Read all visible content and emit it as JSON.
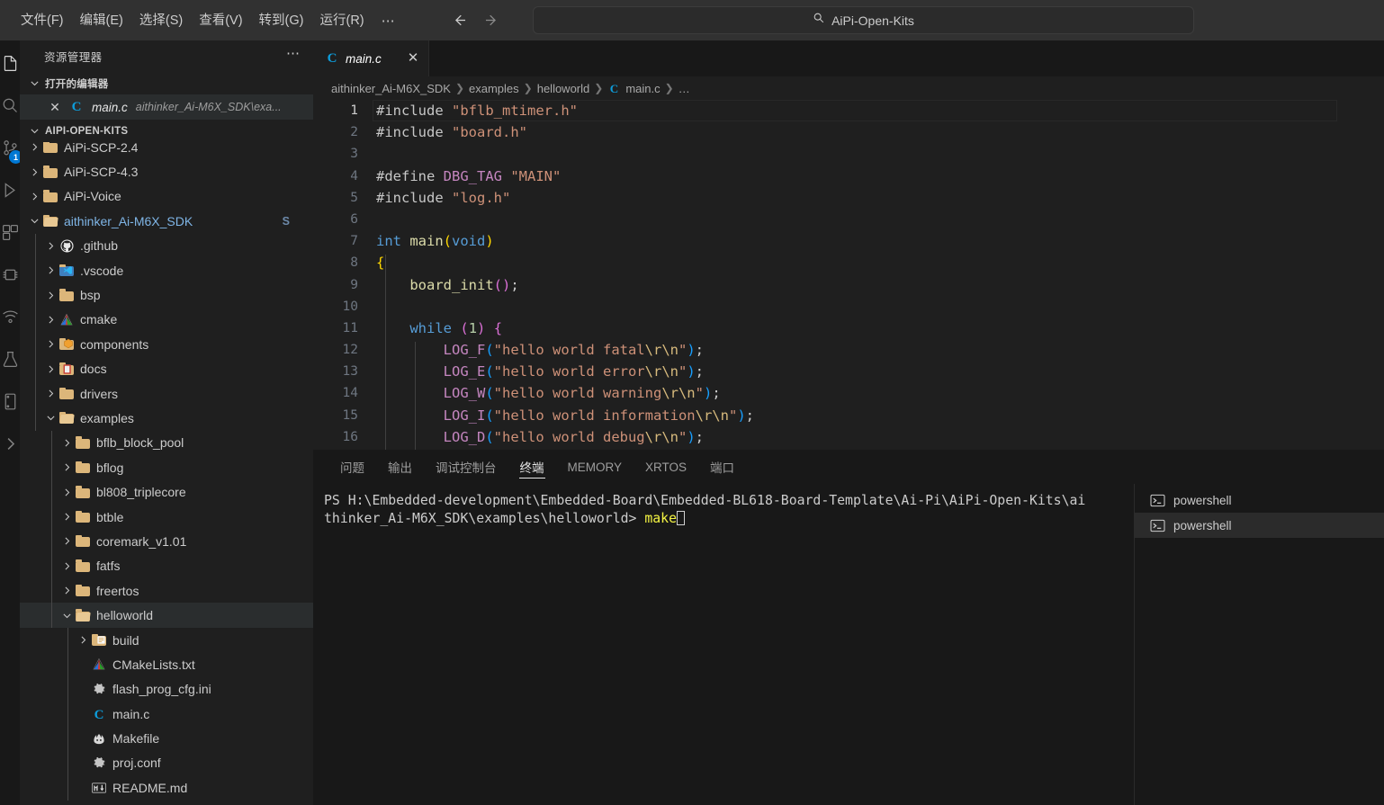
{
  "titlebar": {
    "menus": [
      "文件(F)",
      "编辑(E)",
      "选择(S)",
      "查看(V)",
      "转到(G)",
      "运行(R)"
    ],
    "more_label": "⋯",
    "back_icon": "arrow-left-icon",
    "forward_icon": "arrow-right-icon",
    "search": {
      "icon": "search-icon",
      "text": "AiPi-Open-Kits"
    }
  },
  "activitybar": {
    "items": [
      {
        "name": "explorer",
        "icon": "files-icon",
        "active": true
      },
      {
        "name": "search",
        "icon": "search-icon"
      },
      {
        "name": "source-control",
        "icon": "source-control-icon",
        "badge": "1"
      },
      {
        "name": "run-and-debug",
        "icon": "run-debug-icon"
      },
      {
        "name": "extensions",
        "icon": "extensions-icon"
      },
      {
        "name": "platformio",
        "icon": "platformio-icon"
      },
      {
        "name": "remote-explorer",
        "icon": "remote-icon"
      },
      {
        "name": "test",
        "icon": "beaker-icon"
      },
      {
        "name": "serial-monitor",
        "icon": "serial-icon"
      },
      {
        "name": "more-views",
        "icon": "chevron-right-icon"
      }
    ]
  },
  "sidebar": {
    "title": "资源管理器",
    "more_icon": "ellipsis-icon",
    "open_editors": {
      "label": "打开的编辑器",
      "items": [
        {
          "close_icon": "close-icon",
          "file_icon": "c-file-icon",
          "name": "main.c",
          "path": "aithinker_Ai-M6X_SDK\\exa..."
        }
      ]
    },
    "workspace": {
      "label": "AIPI-OPEN-KITS",
      "tree": [
        {
          "label": "AiPi-SCP-2.4",
          "depth": 1,
          "type": "folder",
          "state": "collapsed",
          "clipped": true
        },
        {
          "label": "AiPi-SCP-4.3",
          "depth": 1,
          "type": "folder",
          "state": "collapsed"
        },
        {
          "label": "AiPi-Voice",
          "depth": 1,
          "type": "folder",
          "state": "collapsed"
        },
        {
          "label": "aithinker_Ai-M6X_SDK",
          "depth": 1,
          "type": "folder",
          "state": "expanded",
          "accent": true,
          "git_badge": "S"
        },
        {
          "label": ".github",
          "depth": 2,
          "type": "github",
          "state": "collapsed"
        },
        {
          "label": ".vscode",
          "depth": 2,
          "type": "vscode",
          "state": "collapsed"
        },
        {
          "label": "bsp",
          "depth": 2,
          "type": "folder",
          "state": "collapsed"
        },
        {
          "label": "cmake",
          "depth": 2,
          "type": "cmake",
          "state": "collapsed"
        },
        {
          "label": "components",
          "depth": 2,
          "type": "components",
          "state": "collapsed"
        },
        {
          "label": "docs",
          "depth": 2,
          "type": "docs",
          "state": "collapsed"
        },
        {
          "label": "drivers",
          "depth": 2,
          "type": "folder",
          "state": "collapsed"
        },
        {
          "label": "examples",
          "depth": 2,
          "type": "folder",
          "state": "expanded"
        },
        {
          "label": "bflb_block_pool",
          "depth": 3,
          "type": "folder",
          "state": "collapsed"
        },
        {
          "label": "bflog",
          "depth": 3,
          "type": "folder",
          "state": "collapsed"
        },
        {
          "label": "bl808_triplecore",
          "depth": 3,
          "type": "folder",
          "state": "collapsed"
        },
        {
          "label": "btble",
          "depth": 3,
          "type": "folder",
          "state": "collapsed"
        },
        {
          "label": "coremark_v1.01",
          "depth": 3,
          "type": "folder",
          "state": "collapsed"
        },
        {
          "label": "fatfs",
          "depth": 3,
          "type": "folder",
          "state": "collapsed"
        },
        {
          "label": "freertos",
          "depth": 3,
          "type": "folder",
          "state": "collapsed"
        },
        {
          "label": "helloworld",
          "depth": 3,
          "type": "folder",
          "state": "expanded",
          "selected": true
        },
        {
          "label": "build",
          "depth": 4,
          "type": "buildfolder",
          "state": "collapsed"
        },
        {
          "label": "CMakeLists.txt",
          "depth": 4,
          "type": "cmakefile",
          "state": "leaf"
        },
        {
          "label": "flash_prog_cfg.ini",
          "depth": 4,
          "type": "gear",
          "state": "leaf"
        },
        {
          "label": "main.c",
          "depth": 4,
          "type": "cfile",
          "state": "leaf"
        },
        {
          "label": "Makefile",
          "depth": 4,
          "type": "makefile",
          "state": "leaf"
        },
        {
          "label": "proj.conf",
          "depth": 4,
          "type": "gear",
          "state": "leaf"
        },
        {
          "label": "README.md",
          "depth": 4,
          "type": "markdown",
          "state": "leaf",
          "clipped": true
        }
      ]
    }
  },
  "editor": {
    "tabs": [
      {
        "icon": "c-file-icon",
        "label": "main.c",
        "close_icon": "close-icon",
        "active": true
      }
    ],
    "breadcrumb": [
      {
        "label": "aithinker_Ai-M6X_SDK"
      },
      {
        "label": "examples"
      },
      {
        "label": "helloworld"
      },
      {
        "label": "main.c",
        "icon": "c-file-icon"
      },
      {
        "label": "…"
      }
    ],
    "code_lines": [
      {
        "n": 1,
        "current": true,
        "tokens": [
          {
            "t": "#include ",
            "c": "t-pre"
          },
          {
            "t": "\"bflb_mtimer.h\"",
            "c": "t-str"
          }
        ]
      },
      {
        "n": 2,
        "tokens": [
          {
            "t": "#include ",
            "c": "t-pre"
          },
          {
            "t": "\"board.h\"",
            "c": "t-str"
          }
        ]
      },
      {
        "n": 3,
        "tokens": []
      },
      {
        "n": 4,
        "tokens": [
          {
            "t": "#define ",
            "c": "t-pre"
          },
          {
            "t": "DBG_TAG",
            "c": "t-macro"
          },
          {
            "t": " ",
            "c": "t-pre"
          },
          {
            "t": "\"MAIN\"",
            "c": "t-str"
          }
        ]
      },
      {
        "n": 5,
        "tokens": [
          {
            "t": "#include ",
            "c": "t-pre"
          },
          {
            "t": "\"log.h\"",
            "c": "t-str"
          }
        ]
      },
      {
        "n": 6,
        "tokens": []
      },
      {
        "n": 7,
        "tokens": [
          {
            "t": "int",
            "c": "t-kw"
          },
          {
            "t": " ",
            "c": "t-pre"
          },
          {
            "t": "main",
            "c": "t-fn"
          },
          {
            "t": "(",
            "c": "t-p1"
          },
          {
            "t": "void",
            "c": "t-kw"
          },
          {
            "t": ")",
            "c": "t-p1"
          }
        ]
      },
      {
        "n": 8,
        "tokens": [
          {
            "t": "{",
            "c": "t-p1"
          }
        ]
      },
      {
        "n": 9,
        "tokens": [
          {
            "t": "    ",
            "c": "t-pre"
          },
          {
            "t": "board_init",
            "c": "t-fn"
          },
          {
            "t": "()",
            "c": "t-p2"
          },
          {
            "t": ";",
            "c": "t-punc"
          }
        ]
      },
      {
        "n": 10,
        "tokens": []
      },
      {
        "n": 11,
        "tokens": [
          {
            "t": "    ",
            "c": "t-pre"
          },
          {
            "t": "while",
            "c": "t-kw"
          },
          {
            "t": " ",
            "c": "t-pre"
          },
          {
            "t": "(",
            "c": "t-p2"
          },
          {
            "t": "1",
            "c": "t-num"
          },
          {
            "t": ")",
            "c": "t-p2"
          },
          {
            "t": " ",
            "c": "t-pre"
          },
          {
            "t": "{",
            "c": "t-p2"
          }
        ]
      },
      {
        "n": 12,
        "tokens": [
          {
            "t": "        ",
            "c": "t-pre"
          },
          {
            "t": "LOG_F",
            "c": "t-macro"
          },
          {
            "t": "(",
            "c": "t-p3"
          },
          {
            "t": "\"hello world fatal",
            "c": "t-str"
          },
          {
            "t": "\\r\\n",
            "c": "t-esc"
          },
          {
            "t": "\"",
            "c": "t-str"
          },
          {
            "t": ")",
            "c": "t-p3"
          },
          {
            "t": ";",
            "c": "t-punc"
          }
        ]
      },
      {
        "n": 13,
        "tokens": [
          {
            "t": "        ",
            "c": "t-pre"
          },
          {
            "t": "LOG_E",
            "c": "t-macro"
          },
          {
            "t": "(",
            "c": "t-p3"
          },
          {
            "t": "\"hello world error",
            "c": "t-str"
          },
          {
            "t": "\\r\\n",
            "c": "t-esc"
          },
          {
            "t": "\"",
            "c": "t-str"
          },
          {
            "t": ")",
            "c": "t-p3"
          },
          {
            "t": ";",
            "c": "t-punc"
          }
        ]
      },
      {
        "n": 14,
        "tokens": [
          {
            "t": "        ",
            "c": "t-pre"
          },
          {
            "t": "LOG_W",
            "c": "t-macro"
          },
          {
            "t": "(",
            "c": "t-p3"
          },
          {
            "t": "\"hello world warning",
            "c": "t-str"
          },
          {
            "t": "\\r\\n",
            "c": "t-esc"
          },
          {
            "t": "\"",
            "c": "t-str"
          },
          {
            "t": ")",
            "c": "t-p3"
          },
          {
            "t": ";",
            "c": "t-punc"
          }
        ]
      },
      {
        "n": 15,
        "tokens": [
          {
            "t": "        ",
            "c": "t-pre"
          },
          {
            "t": "LOG_I",
            "c": "t-macro"
          },
          {
            "t": "(",
            "c": "t-p3"
          },
          {
            "t": "\"hello world information",
            "c": "t-str"
          },
          {
            "t": "\\r\\n",
            "c": "t-esc"
          },
          {
            "t": "\"",
            "c": "t-str"
          },
          {
            "t": ")",
            "c": "t-p3"
          },
          {
            "t": ";",
            "c": "t-punc"
          }
        ]
      },
      {
        "n": 16,
        "tokens": [
          {
            "t": "        ",
            "c": "t-pre"
          },
          {
            "t": "LOG_D",
            "c": "t-macro"
          },
          {
            "t": "(",
            "c": "t-p3"
          },
          {
            "t": "\"hello world debug",
            "c": "t-str"
          },
          {
            "t": "\\r\\n",
            "c": "t-esc"
          },
          {
            "t": "\"",
            "c": "t-str"
          },
          {
            "t": ")",
            "c": "t-p3"
          },
          {
            "t": ";",
            "c": "t-punc"
          }
        ]
      }
    ]
  },
  "panel": {
    "tabs": [
      {
        "label": "问题"
      },
      {
        "label": "输出"
      },
      {
        "label": "调试控制台"
      },
      {
        "label": "终端",
        "active": true
      },
      {
        "label": "MEMORY"
      },
      {
        "label": "XRTOS"
      },
      {
        "label": "端口"
      }
    ],
    "terminal": {
      "line1": "PS H:\\Embedded-development\\Embedded-Board\\Embedded-BL618-Board-Template\\Ai-Pi\\AiPi-Open-Kits\\ai",
      "line2_prefix": "thinker_Ai-M6X_SDK\\examples\\helloworld> ",
      "command": "make"
    },
    "terminal_list": [
      {
        "icon": "terminal-icon",
        "label": "powershell",
        "active": false
      },
      {
        "icon": "terminal-icon",
        "label": "powershell",
        "active": true
      }
    ]
  },
  "colors": {
    "accent": "#0078d4",
    "titlebar_bg": "#313131",
    "sidebar_bg": "#1f1f1f",
    "panel_bg": "#181818",
    "selection_bg": "#2a2d2e",
    "folder_icon": "#dcb67a",
    "c_icon": "#0d9ddb",
    "command_yellow": "#f5f543"
  }
}
